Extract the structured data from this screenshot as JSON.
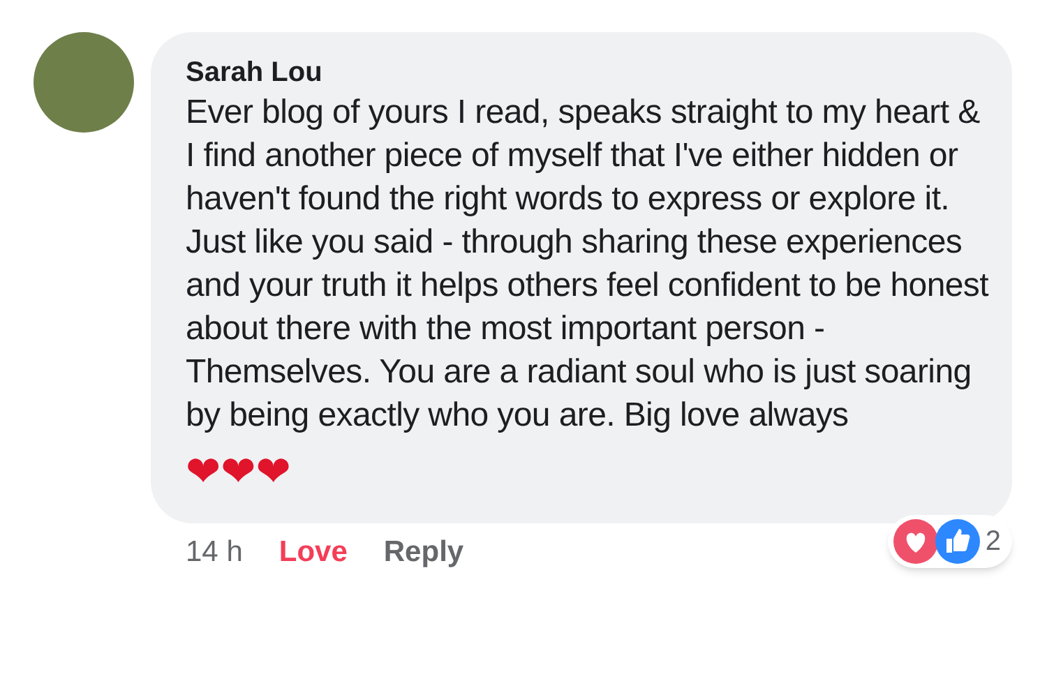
{
  "comment": {
    "author": "Sarah Lou",
    "text": "Ever blog of yours I read, speaks straight to my heart & I find another piece of myself that I've either hidden or haven't found the right words to express or explore it. Just like you said - through sharing these experiences and your truth it helps others feel confident to be honest about there with the most important person - Themselves. You are a radiant soul who is just soaring by being exactly who you are. Big love always",
    "emoji": "❤❤❤",
    "time": "14 h",
    "reaction": {
      "label": "Love",
      "selected": true
    },
    "reply": "Reply",
    "reactions_count": "2"
  }
}
